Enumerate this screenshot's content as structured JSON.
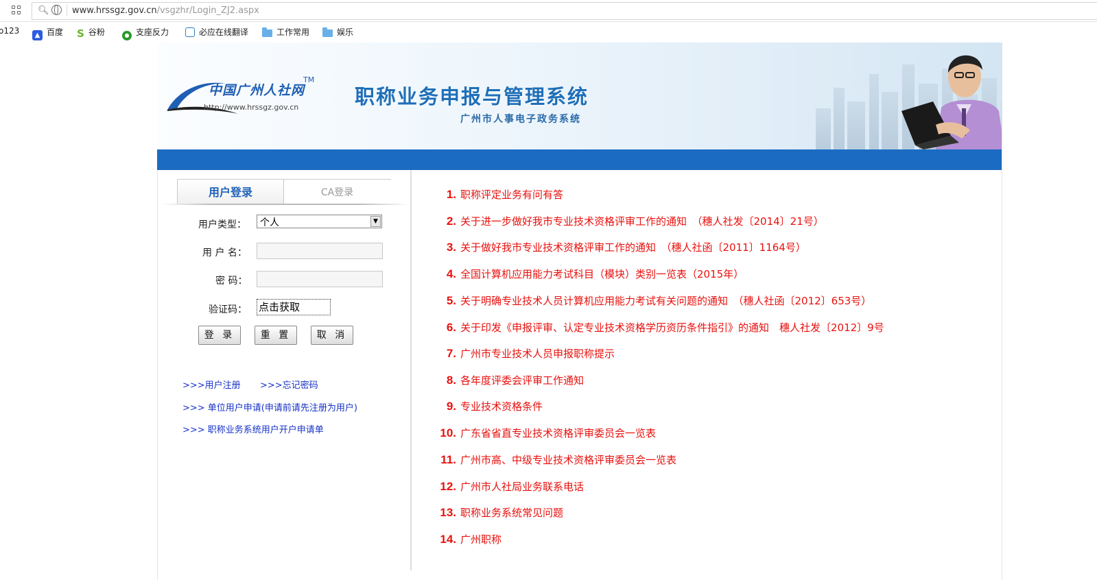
{
  "browser": {
    "url_host": "www.hrssgz.gov.cn",
    "url_path": "/vsgzhr/Login_ZJ2.aspx",
    "bookmarks": [
      "o123",
      "百度",
      "谷粉",
      "支座反力",
      "必应在线翻译",
      "工作常用",
      "娱乐"
    ]
  },
  "banner": {
    "logo_text": "中国广州人社网",
    "logo_tm": "TM",
    "logo_url": "http://www.hrssgz.gov.cn",
    "title": "职称业务申报与管理系统",
    "subtitle": "广州市人事电子政务系统"
  },
  "login": {
    "tabs": [
      "用户登录",
      "CA登录"
    ],
    "user_type_label": "用户类型：",
    "user_type_value": "个人",
    "username_label": "用 户 名：",
    "password_label": "密 码：",
    "captcha_label": "验证码：",
    "captcha_value": "点击获取",
    "buttons": {
      "login": "登 录",
      "reset": "重 置",
      "cancel": "取 消"
    },
    "links": {
      "register": ">>>用户注册",
      "forgot": ">>>忘记密码",
      "unit_apply": ">>> 单位用户申请(申请前请先注册为用户)",
      "account_form": ">>> 职称业务系统用户开户申请单"
    }
  },
  "notices": [
    {
      "num": "1.",
      "text": "职称评定业务有问有答"
    },
    {
      "num": "2.",
      "text": "关于进一步做好我市专业技术资格评审工作的通知　（穗人社发〔2014〕21号）"
    },
    {
      "num": "3.",
      "text": "关于做好我市专业技术资格评审工作的通知　（穗人社函〔2011〕1164号）"
    },
    {
      "num": "4.",
      "text": "全国计算机应用能力考试科目（模块）类别一览表（2015年）"
    },
    {
      "num": "5.",
      "text": "关于明确专业技术人员计算机应用能力考试有关问题的通知　（穗人社函〔2012〕653号）"
    },
    {
      "num": "6.",
      "text": "关于印发《申报评审、认定专业技术资格学历资历条件指引》的通知　穗人社发〔2012〕9号"
    },
    {
      "num": "7.",
      "text": "广州市专业技术人员申报职称提示"
    },
    {
      "num": "8.",
      "text": "各年度评委会评审工作通知"
    },
    {
      "num": "9.",
      "text": "专业技术资格条件"
    },
    {
      "num": "10.",
      "text": "广东省省直专业技术资格评审委员会一览表"
    },
    {
      "num": "11.",
      "text": "广州市高、中级专业技术资格评审委员会一览表"
    },
    {
      "num": "12.",
      "text": "广州市人社局业务联系电话"
    },
    {
      "num": "13.",
      "text": "职称业务系统常见问题"
    },
    {
      "num": "14.",
      "text": "广州职称"
    }
  ],
  "colors": {
    "accent_blue": "#1b6bc2",
    "notice_red": "#e8110e",
    "link_blue": "#1530c8"
  }
}
